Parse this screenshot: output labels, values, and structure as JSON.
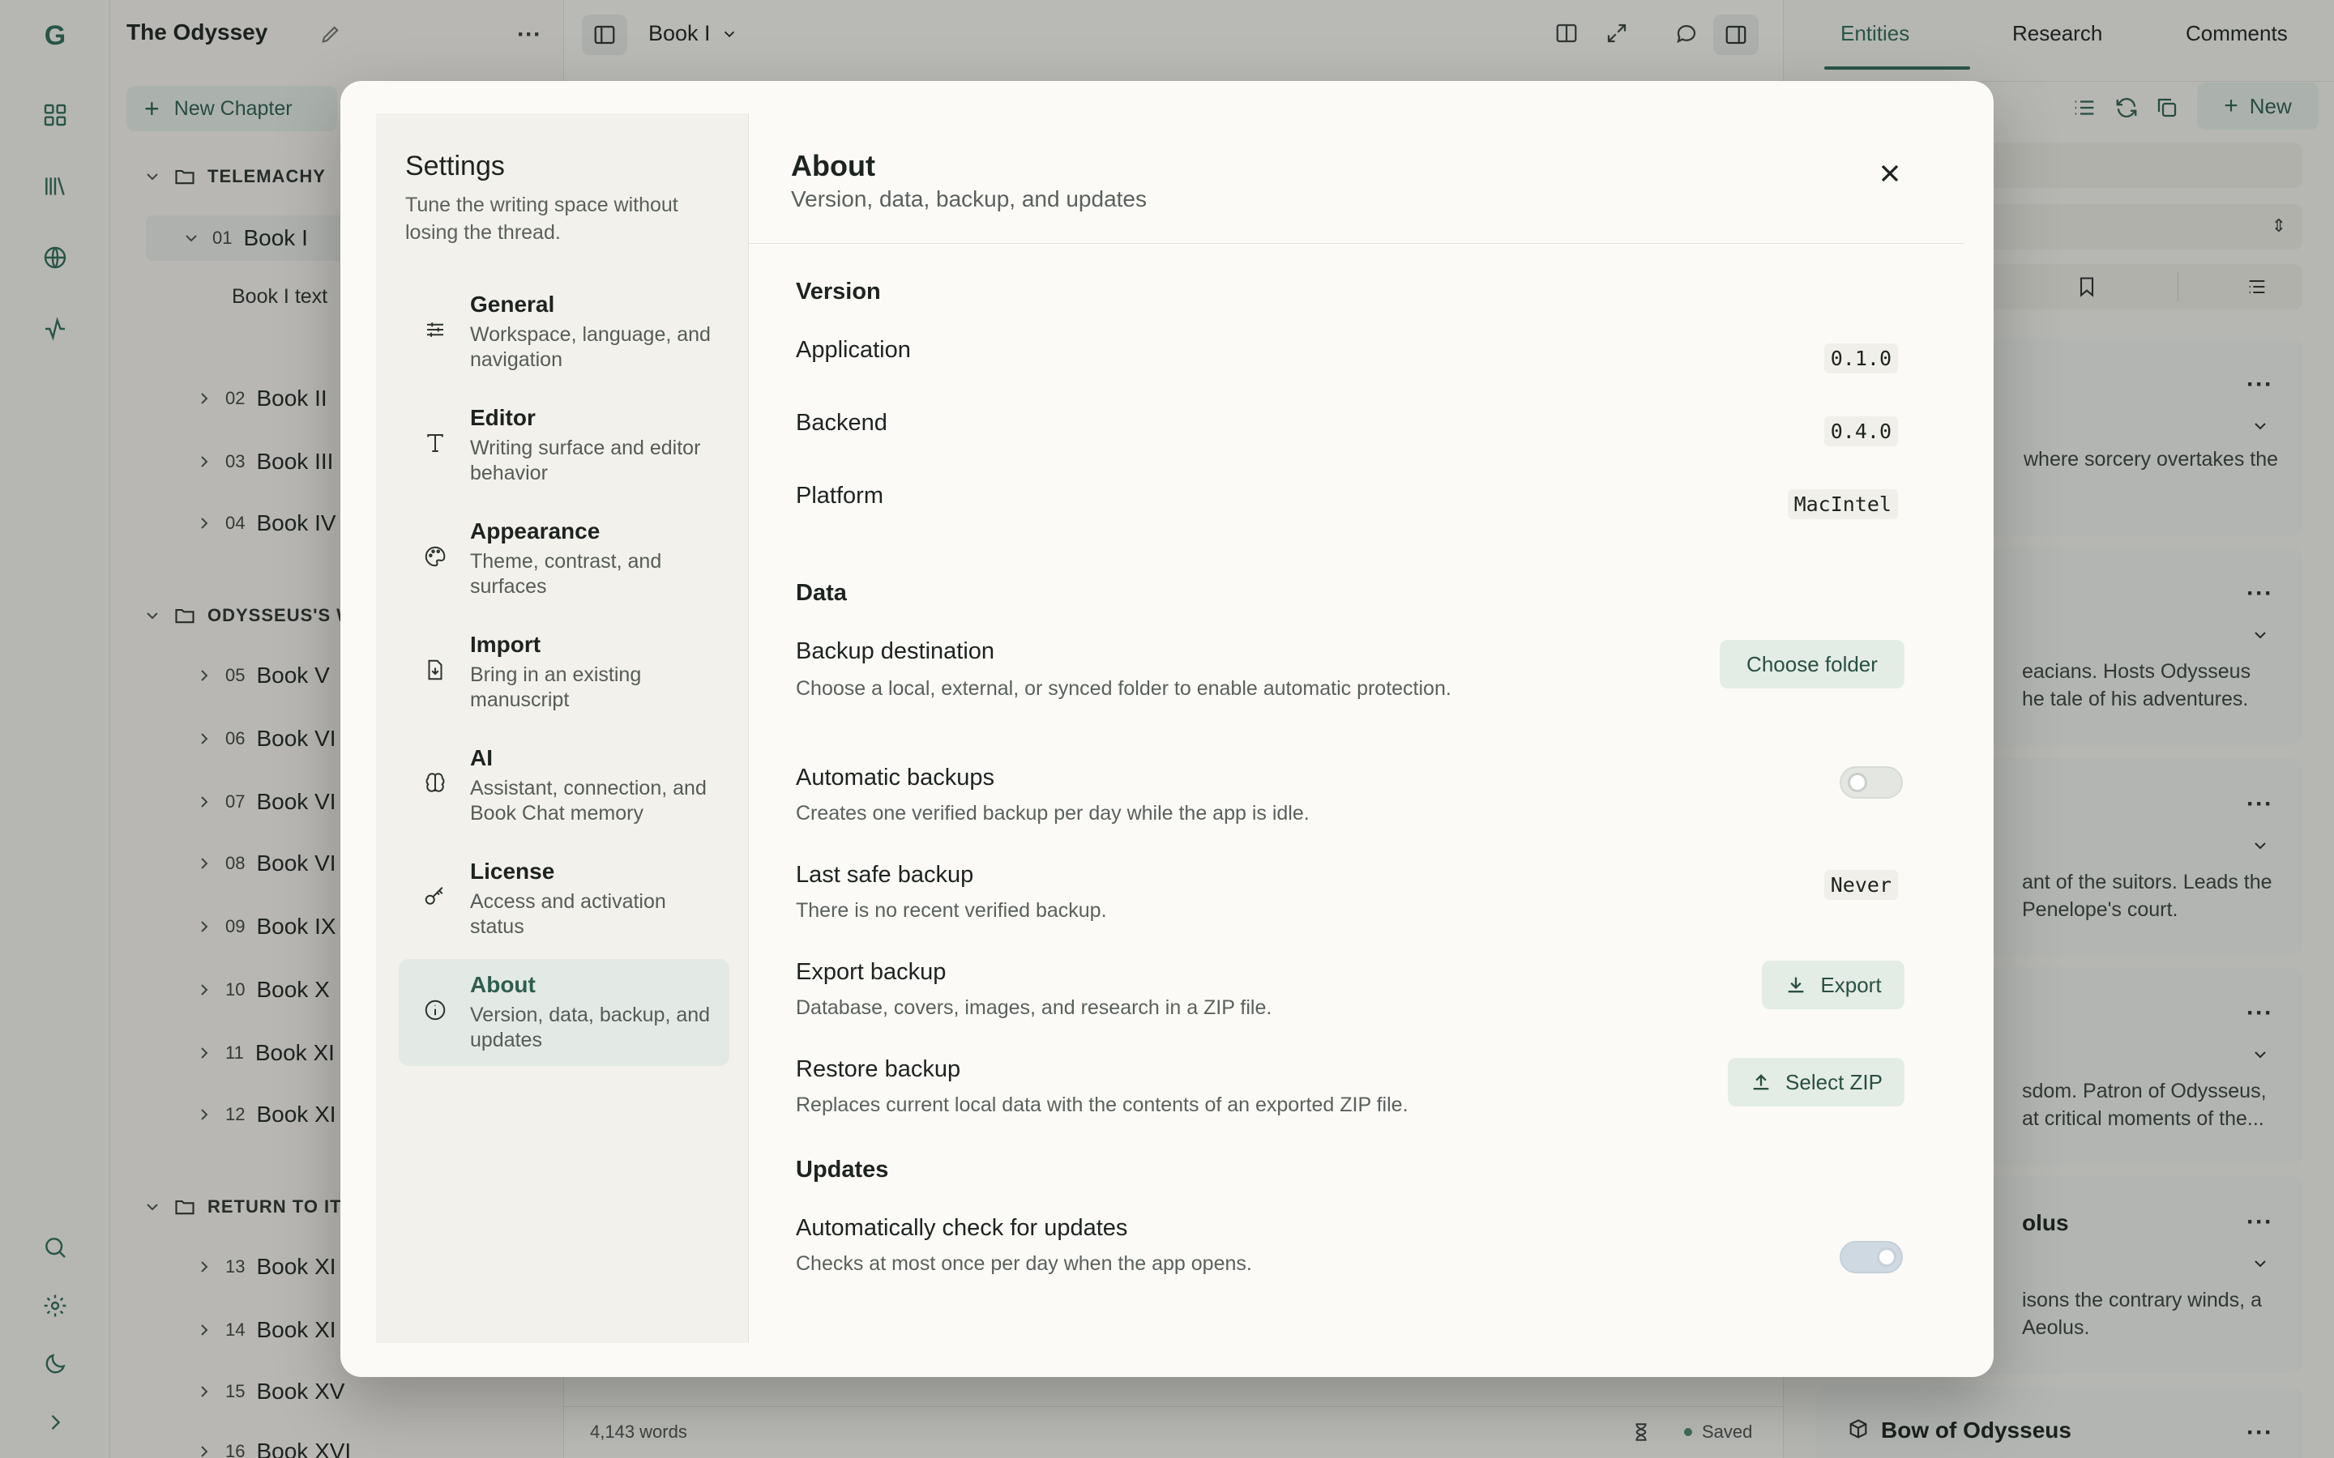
{
  "project": {
    "title": "The Odyssey",
    "new_chapter_label": "New Chapter"
  },
  "outline": {
    "parts": [
      {
        "label": "TELEMACHY"
      },
      {
        "label": "ODYSSEUS'S W"
      },
      {
        "label": "RETURN TO ITI"
      }
    ],
    "chapters": [
      {
        "num": "01",
        "name": "Book I"
      },
      {
        "num": "02",
        "name": "Book II"
      },
      {
        "num": "03",
        "name": "Book III"
      },
      {
        "num": "04",
        "name": "Book IV"
      },
      {
        "num": "05",
        "name": "Book V"
      },
      {
        "num": "06",
        "name": "Book VI"
      },
      {
        "num": "07",
        "name": "Book VI"
      },
      {
        "num": "08",
        "name": "Book VI"
      },
      {
        "num": "09",
        "name": "Book IX"
      },
      {
        "num": "10",
        "name": "Book X"
      },
      {
        "num": "11",
        "name": "Book XI"
      },
      {
        "num": "12",
        "name": "Book XI"
      },
      {
        "num": "13",
        "name": "Book XI"
      },
      {
        "num": "14",
        "name": "Book XI"
      },
      {
        "num": "15",
        "name": "Book XV"
      },
      {
        "num": "16",
        "name": "Book XVI"
      }
    ],
    "sub_item": "Book I text"
  },
  "editor": {
    "chapter_selector": "Book I",
    "word_count": "4,143 words",
    "save_status": "Saved"
  },
  "right_panel": {
    "tabs": [
      "Entities",
      "Research",
      "Comments"
    ],
    "new_label": "New",
    "cards": [
      {
        "line1": "where sorcery overtakes the",
        "line2": ""
      },
      {
        "line1": "eacians. Hosts Odysseus",
        "line2": "he tale of his adventures."
      },
      {
        "line1": "ant of the suitors. Leads the",
        "line2": "Penelope's court."
      },
      {
        "line1": "sdom. Patron of Odysseus,",
        "line2": "at critical moments of the..."
      },
      {
        "title": "olus",
        "line1": "isons the contrary winds, a",
        "line2": "Aeolus."
      },
      {
        "title": "Bow of Odysseus"
      }
    ]
  },
  "settings": {
    "title": "Settings",
    "subtitle": "Tune the writing space without losing the thread.",
    "nav": [
      {
        "title": "General",
        "desc": "Workspace, language, and navigation",
        "icon": "sliders-icon"
      },
      {
        "title": "Editor",
        "desc": "Writing surface and editor behavior",
        "icon": "type-icon"
      },
      {
        "title": "Appearance",
        "desc": "Theme, contrast, and surfaces",
        "icon": "palette-icon"
      },
      {
        "title": "Import",
        "desc": "Bring in an existing manuscript",
        "icon": "file-import-icon"
      },
      {
        "title": "AI",
        "desc": "Assistant, connection, and Book Chat memory",
        "icon": "brain-icon"
      },
      {
        "title": "License",
        "desc": "Access and activation status",
        "icon": "key-icon"
      },
      {
        "title": "About",
        "desc": "Version, data, backup, and updates",
        "icon": "info-icon"
      }
    ],
    "active": "About"
  },
  "about": {
    "title": "About",
    "subtitle": "Version, data, backup, and updates",
    "version_heading": "Version",
    "application_label": "Application",
    "application_value": "0.1.0",
    "backend_label": "Backend",
    "backend_value": "0.4.0",
    "platform_label": "Platform",
    "platform_value": "MacIntel",
    "data_heading": "Data",
    "backup_dest_label": "Backup destination",
    "backup_dest_desc": "Choose a local, external, or synced folder to enable automatic protection.",
    "choose_folder_label": "Choose folder",
    "auto_backup_label": "Automatic backups",
    "auto_backup_desc": "Creates one verified backup per day while the app is idle.",
    "auto_backup_on": false,
    "last_backup_label": "Last safe backup",
    "last_backup_desc": "There is no recent verified backup.",
    "last_backup_value": "Never",
    "export_label": "Export backup",
    "export_desc": "Database, covers, images, and research in a ZIP file.",
    "export_button": "Export",
    "restore_label": "Restore backup",
    "restore_desc": "Replaces current local data with the contents of an exported ZIP file.",
    "restore_button": "Select ZIP",
    "updates_heading": "Updates",
    "auto_update_label": "Automatically check for updates",
    "auto_update_desc": "Checks at most once per day when the app opens.",
    "auto_update_on": true
  },
  "colors": {
    "accent": "#2f6b58",
    "overlay": "rgba(26,30,28,0.28)"
  }
}
